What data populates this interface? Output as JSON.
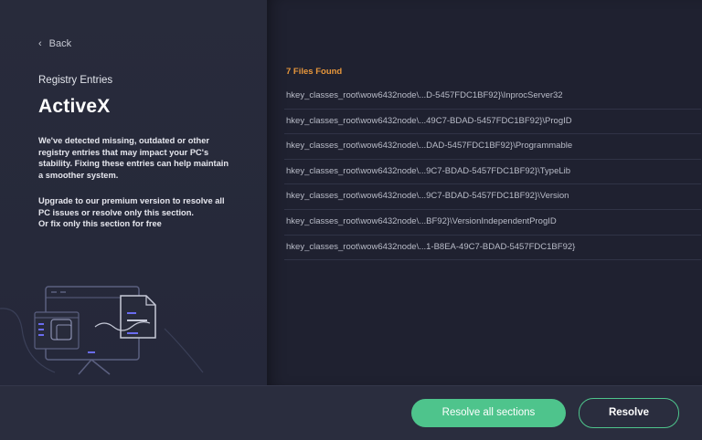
{
  "nav": {
    "back_label": "Back"
  },
  "left": {
    "section_label": "Registry Entries",
    "title": "ActiveX",
    "description": "We've detected missing, outdated or other registry entries that may impact your PC's stability. Fixing these entries can help maintain a smoother system.",
    "upgrade_line1": "Upgrade to our premium version to resolve all",
    "upgrade_line2": "PC issues or resolve only this section.",
    "upgrade_line3": "Or fix only this section for free"
  },
  "results": {
    "found_label": "7 Files Found",
    "entries": [
      "hkey_classes_root\\wow6432node\\...D-5457FDC1BF92}\\InprocServer32",
      "hkey_classes_root\\wow6432node\\...49C7-BDAD-5457FDC1BF92}\\ProgID",
      "hkey_classes_root\\wow6432node\\...DAD-5457FDC1BF92}\\Programmable",
      "hkey_classes_root\\wow6432node\\...9C7-BDAD-5457FDC1BF92}\\TypeLib",
      "hkey_classes_root\\wow6432node\\...9C7-BDAD-5457FDC1BF92}\\Version",
      "hkey_classes_root\\wow6432node\\...BF92}\\VersionIndependentProgID",
      "hkey_classes_root\\wow6432node\\...1-B8EA-49C7-BDAD-5457FDC1BF92}"
    ]
  },
  "footer": {
    "resolve_all_label": "Resolve all sections",
    "resolve_label": "Resolve"
  },
  "colors": {
    "accent_green": "#4ec48c",
    "accent_orange": "#e8973b",
    "panel_left": "#282b3b",
    "panel_right": "#1f2130"
  },
  "icons": [
    "chevron-left-icon",
    "computer-document-illustration"
  ]
}
